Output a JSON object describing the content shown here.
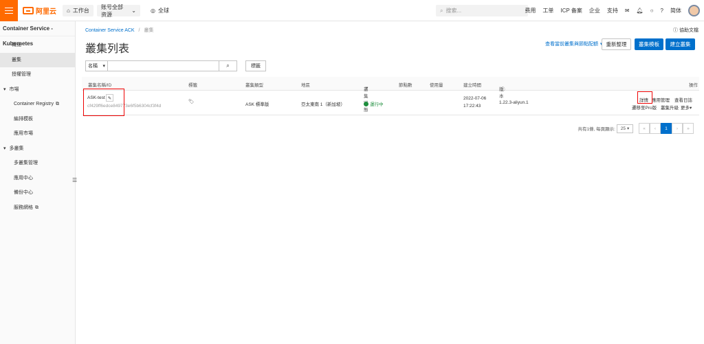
{
  "topbar": {
    "logo": "阿里云",
    "workbench": "工作台",
    "resource_scope": "账号全部资源",
    "region": "全球",
    "search_placeholder": "搜索...",
    "links": [
      "费用",
      "工单",
      "ICP 备案",
      "企业",
      "支持"
    ],
    "lang": "简体"
  },
  "sidebar": {
    "title": "Container Service - Kubernetes",
    "items": [
      {
        "label": "概览"
      },
      {
        "label": "叢集"
      },
      {
        "label": "授權管理"
      },
      {
        "label": "市場"
      },
      {
        "label": "Container Registry"
      },
      {
        "label": "編排模板"
      },
      {
        "label": "應用市場"
      },
      {
        "label": "多叢集"
      },
      {
        "label": "多叢集管理"
      },
      {
        "label": "應用中心"
      },
      {
        "label": "備份中心"
      },
      {
        "label": "服務網格"
      }
    ]
  },
  "breadcrumb": {
    "root": "Container Service ACK",
    "sep": "/",
    "current": "叢集"
  },
  "help": "協助文檔",
  "page_title": "叢集列表",
  "quota_link": "查看當前叢集與節點配額",
  "buttons": {
    "refresh": "重新整理",
    "template": "叢集模板",
    "create": "建立叢集"
  },
  "filter": {
    "select": "名稱",
    "tag": "標籤"
  },
  "table": {
    "headers": [
      "叢集名稱/ID",
      "標籤",
      "叢集類型",
      "地區",
      "叢集狀態",
      "節點數",
      "使用量",
      "建立時間",
      "版本",
      "操作"
    ],
    "row": {
      "name": "ASK-test",
      "id": "cf429ff6edce849773e6f5b6304cf3f4d",
      "type": "ASK 標準版",
      "region": "亞太東南 1（新加坡）",
      "status": "運行中",
      "created_date": "2022-07-06",
      "created_time": "17:22:43",
      "version": "1.22.3-aliyun.1",
      "actions": [
        "詳情",
        "應用管理",
        "查看日誌",
        "遷移至Pro版",
        "叢集升級",
        "更多"
      ]
    }
  },
  "pagination": {
    "summary": "共有1條, 每頁顯示:",
    "page_size": "25",
    "current": "1"
  }
}
